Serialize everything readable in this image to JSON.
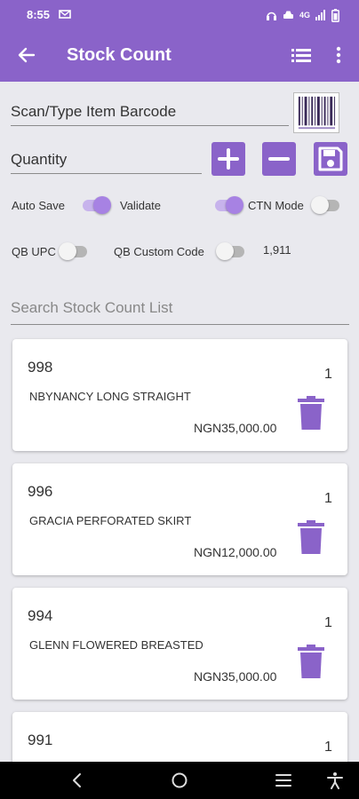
{
  "status_bar": {
    "time": "8:55",
    "network": "4G"
  },
  "app_bar": {
    "title": "Stock Count"
  },
  "barcode_field": {
    "placeholder": "Scan/Type Item Barcode"
  },
  "quantity_field": {
    "placeholder": "Quantity"
  },
  "options": {
    "auto_save": {
      "label": "Auto Save",
      "on": true
    },
    "validate": {
      "label": "Validate",
      "on": true
    },
    "ctn_mode": {
      "label": "CTN Mode",
      "on": false
    },
    "qb_upc": {
      "label": "QB UPC",
      "on": false
    },
    "qb_custom_code": {
      "label": "QB Custom Code",
      "on": false
    }
  },
  "total_count": "1,911",
  "search": {
    "placeholder": "Search Stock Count List"
  },
  "items": [
    {
      "code": "998",
      "name": "NBYNANCY LONG STRAIGHT",
      "price": "NGN35,000.00",
      "qty": "1"
    },
    {
      "code": "996",
      "name": "GRACIA PERFORATED SKIRT",
      "price": "NGN12,000.00",
      "qty": "1"
    },
    {
      "code": "994",
      "name": "GLENN FLOWERED BREASTED",
      "price": "NGN35,000.00",
      "qty": "1"
    },
    {
      "code": "991",
      "qty": "1"
    }
  ],
  "colors": {
    "accent": "#8a63c9",
    "switch_on": "#a782e3",
    "background": "#e9e9ee"
  }
}
